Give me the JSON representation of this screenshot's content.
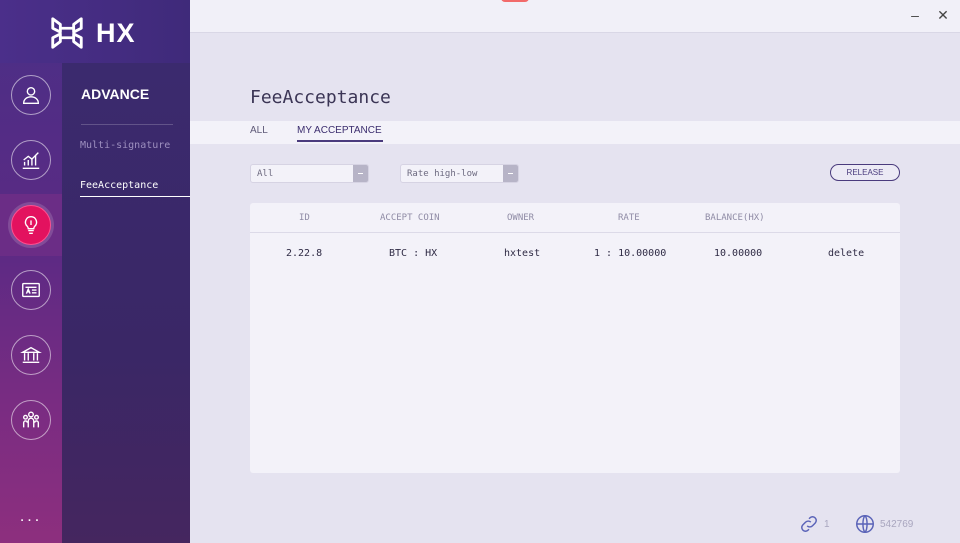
{
  "app": {
    "logo_text": "HX"
  },
  "rail": {
    "items": [
      {
        "icon": "user-icon"
      },
      {
        "icon": "chart-icon"
      },
      {
        "icon": "lightbulb-icon",
        "active": true
      },
      {
        "icon": "id-card-icon"
      },
      {
        "icon": "bank-icon"
      },
      {
        "icon": "users-group-icon"
      }
    ],
    "more": "..."
  },
  "submenu": {
    "title": "ADVANCE",
    "items": [
      "Multi-signature",
      "FeeAcceptance"
    ],
    "active_index": 1
  },
  "page": {
    "title": "FeeAcceptance",
    "tabs": [
      "ALL",
      "MY ACCEPTANCE"
    ],
    "active_tab": 1
  },
  "filters": {
    "coin_select": "All",
    "sort_select": "Rate high-low",
    "release_label": "RELEASE"
  },
  "table": {
    "headers": [
      "ID",
      "ACCEPT COIN",
      "OWNER",
      "RATE",
      "BALANCE(HX)"
    ],
    "rows": [
      {
        "id": "2.22.8",
        "accept_coin": "BTC : HX",
        "owner": "hxtest",
        "rate": "1 : 10.00000",
        "balance": "10.00000",
        "action": "delete"
      }
    ]
  },
  "status": {
    "connections": "1",
    "block_height": "542769"
  },
  "colors": {
    "accent": "#e3125f",
    "brand": "#4a3b7d"
  }
}
